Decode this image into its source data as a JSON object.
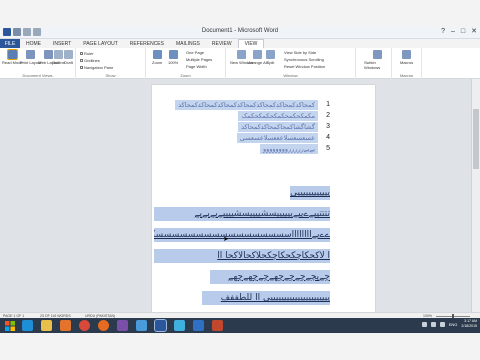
{
  "window": {
    "title": "Document1 - Microsoft Word",
    "controls": [
      "?",
      "–",
      "□",
      "✕"
    ]
  },
  "tabs": {
    "file": "FILE",
    "items": [
      "HOME",
      "INSERT",
      "PAGE LAYOUT",
      "REFERENCES",
      "MAILINGS",
      "REVIEW",
      "VIEW"
    ]
  },
  "ribbon": {
    "groups": [
      {
        "label": "Document Views",
        "buttons": [
          "Read Mode",
          "Print Layout",
          "Web Layout"
        ],
        "extra": [
          "Outline",
          "Draft"
        ]
      },
      {
        "label": "Show",
        "checks": [
          "Ruler",
          "Gridlines",
          "Navigation Pane"
        ]
      },
      {
        "label": "Zoom",
        "buttons": [
          "Zoom",
          "100%"
        ],
        "options": [
          "One Page",
          "Multiple Pages",
          "Page Width"
        ]
      },
      {
        "label": "Window",
        "buttons": [
          "New Window",
          "Arrange All",
          "Split"
        ],
        "options": [
          "View Side by Side",
          "Synchronous Scrolling",
          "Reset Window Position"
        ]
      },
      {
        "label": "",
        "buttons": [
          "Switch Windows"
        ]
      },
      {
        "label": "Macros",
        "buttons": [
          "Macros"
        ]
      }
    ]
  },
  "document": {
    "list_items": [
      {
        "num": "1",
        "text": "کمحاکدکمحاکدکمحاکدکمحاکدکمحاکدکمحاکدکمحاکد"
      },
      {
        "num": "2",
        "text": "مکمکحکمحکمکحکمکحکمک"
      },
      {
        "num": "3",
        "text": "گشاگشاکمحاکمحاکدکمحاکد"
      },
      {
        "num": "4",
        "text": "عسعسعسلاعععسلاعسعسی"
      },
      {
        "num": "5",
        "text": "یےیےررررروووووووو"
      }
    ],
    "paragraph_lines": [
      "ییییییییییییی :",
      "تتتتییےےییےییییییسشییییسشییییےیےیےیے",
      "ےےیےااااااااسسسسسسسسسسسسسسسسسکسکسک",
      "ا لاکحکاچکحکاچکحلاکحالاکحا اا",
      "چےیچےچےچےچھےچےچھےچھے",
      "ییییییییییییییییییییییی اا للطففف"
    ]
  },
  "statusbar": {
    "page": "PAGE 1 OF 1",
    "words": "23 OF 116 WORDS",
    "language": "URDU (PAKISTAN)",
    "zoom": "100%",
    "zoom_level": 0.5
  },
  "taskbar": {
    "apps": [
      "Internet Explorer",
      "File Explorer",
      "Media Player",
      "Chrome",
      "Firefox",
      "Visual Studio",
      "Photos",
      "Word",
      "Store",
      "Outlook",
      "Paint"
    ],
    "language": "ENG",
    "time": "3:17 AM",
    "date": "2/18/2015"
  }
}
